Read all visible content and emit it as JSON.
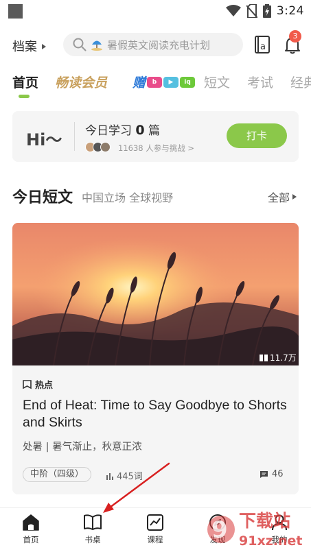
{
  "status_bar": {
    "time": "3:24"
  },
  "top_bar": {
    "archive_label": "档案",
    "search_placeholder": "暑假英文阅读充电计划",
    "notification_count": "3"
  },
  "tabs": [
    {
      "label": "首页",
      "active": true
    },
    {
      "label": "畅读会员"
    },
    {
      "label": "赠"
    },
    {
      "label": "短文"
    },
    {
      "label": "考试"
    },
    {
      "label": "经典"
    }
  ],
  "checkin": {
    "greeting": "Hi～",
    "today_prefix": "今日学习",
    "today_count": "0",
    "today_suffix": "篇",
    "participants": "11638 人参与挑战 >",
    "button": "打卡"
  },
  "section": {
    "title": "今日短文",
    "subtitle": "中国立场 全球视野",
    "all_label": "全部"
  },
  "article": {
    "views": "11.7万",
    "tag": "热点",
    "title": "End of Heat: Time to Say Goodbye to Shorts and Skirts",
    "description": "处暑 | 暑气渐止，秋意正浓",
    "level": "中阶（四级）",
    "word_count": "445词",
    "comments": "46"
  },
  "bottom_nav": [
    {
      "label": "首页",
      "icon": "home-icon"
    },
    {
      "label": "书桌",
      "icon": "book-icon"
    },
    {
      "label": "课程",
      "icon": "chart-icon"
    },
    {
      "label": "发现",
      "icon": "compass-icon"
    },
    {
      "label": "我的",
      "icon": "person-icon"
    }
  ],
  "watermark": {
    "text": "下载站",
    "domain": "91xz.net"
  },
  "colors": {
    "accent": "#8bc84a",
    "badge": "#f15a4a",
    "vip": "#c9a15e"
  }
}
